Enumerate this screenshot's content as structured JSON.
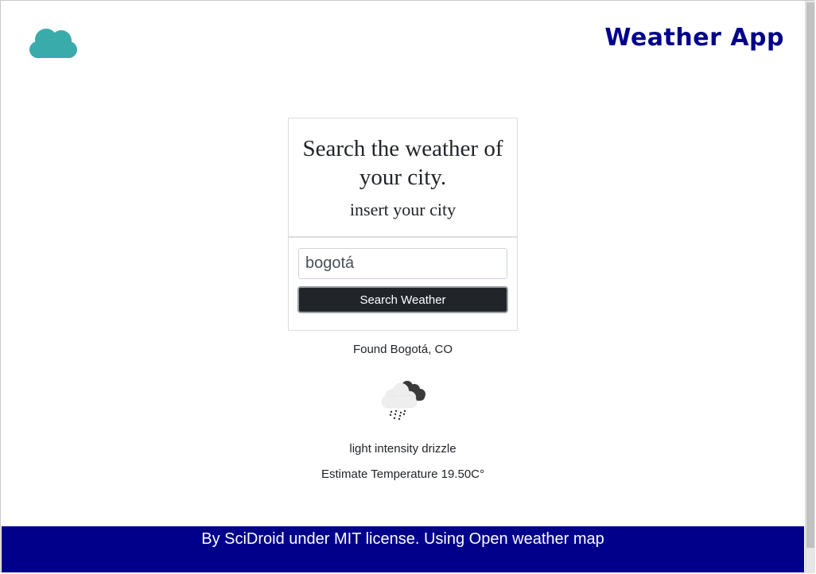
{
  "header": {
    "title": "Weather App",
    "logo_icon": "cloud-icon",
    "logo_color": "#3aabab"
  },
  "search_card": {
    "heading": "Search the weather of your city.",
    "subheading": "insert your city"
  },
  "form": {
    "city_value": "bogotá",
    "button_label": "Search Weather"
  },
  "result": {
    "found_text": "Found Bogotá, CO",
    "icon": "rain-cloud-icon",
    "description": "light intensity drizzle",
    "temperature_label": "Estimate Temperature",
    "temperature_value": "19.50C°"
  },
  "footer": {
    "text": "By SciDroid under MIT license. Using Open weather map",
    "background": "#00008b"
  }
}
